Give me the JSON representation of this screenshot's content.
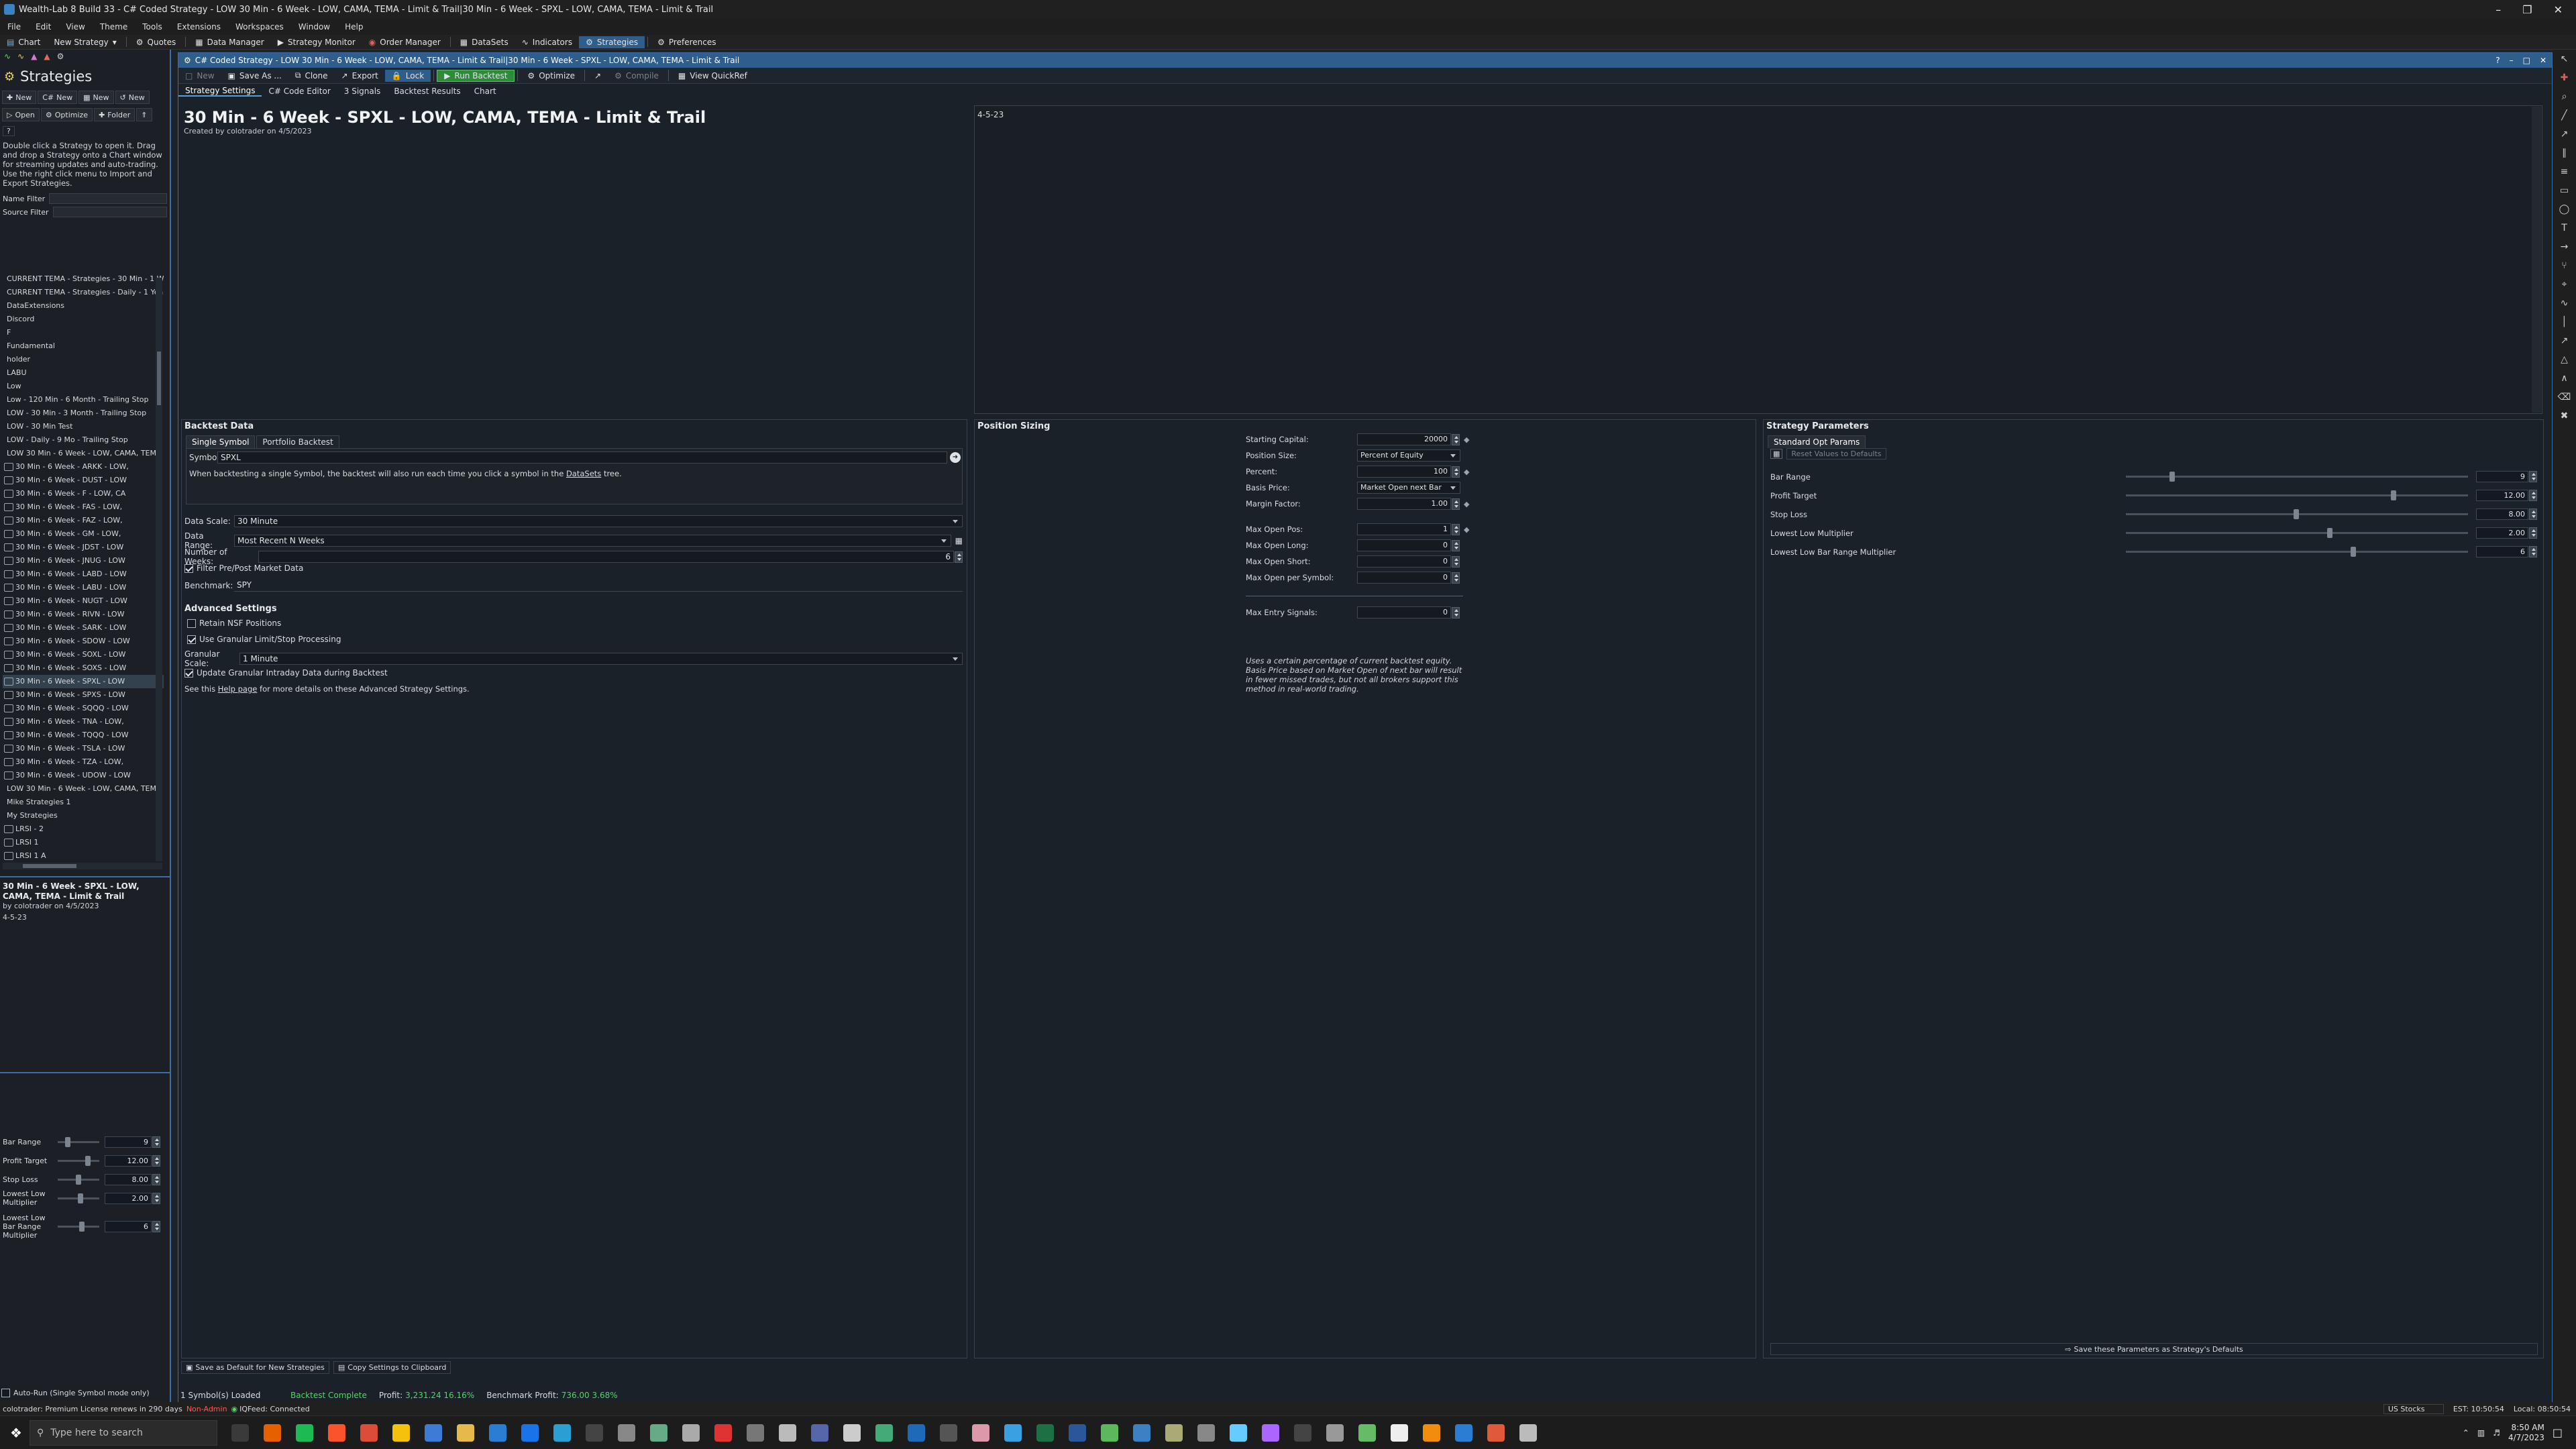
{
  "window": {
    "title": "Wealth-Lab 8 Build 33 - C# Coded Strategy - LOW 30 Min - 6 Week - LOW, CAMA, TEMA - Limit & Trail|30 Min - 6 Week - SPXL - LOW, CAMA, TEMA - Limit & Trail"
  },
  "menu": [
    "File",
    "Edit",
    "View",
    "Theme",
    "Tools",
    "Extensions",
    "Workspaces",
    "Window",
    "Help"
  ],
  "toolbar": {
    "chart": "Chart",
    "new_strategy": "New Strategy",
    "quotes": "Quotes",
    "data_manager": "Data Manager",
    "strategy_monitor": "Strategy Monitor",
    "order_manager": "Order Manager",
    "datasets": "DataSets",
    "indicators": "Indicators",
    "strategies": "Strategies",
    "preferences": "Preferences"
  },
  "left": {
    "title": "Strategies",
    "buttons1": [
      "New",
      "New",
      "New",
      "New"
    ],
    "buttons2": [
      "Open",
      "Optimize",
      "Folder"
    ],
    "hint": "Double click a Strategy to open it. Drag and drop a Strategy onto a Chart window for streaming updates and auto-trading. Use the right click menu to Import and Export Strategies.",
    "name_filter": "Name Filter",
    "source_filter": "Source Filter",
    "folders": [
      "CURRENT TEMA - Strategies - 30 Min - 1 W",
      "CURRENT TEMA - Strategies - Daily - 1 Year",
      "DataExtensions",
      "Discord",
      "F",
      "Fundamental",
      "holder",
      "LABU",
      "Low",
      "Low - 120 Min - 6 Month - Trailing Stop",
      "LOW - 30 Min - 3 Month - Trailing Stop",
      "LOW - 30 Min Test",
      "LOW - Daily - 9 Mo - Trailing Stop",
      "LOW 30 Min - 6 Week - LOW, CAMA, TEMA"
    ],
    "strategies": [
      "30 Min - 6 Week - ARKK - LOW,",
      "30 Min - 6 Week - DUST - LOW",
      "30 Min - 6 Week - F - LOW, CA",
      "30 Min - 6 Week - FAS - LOW,",
      "30 Min - 6 Week - FAZ - LOW,",
      "30 Min - 6 Week - GM - LOW,",
      "30 Min - 6 Week - JDST - LOW",
      "30 Min - 6 Week - JNUG - LOW",
      "30 Min - 6 Week - LABD - LOW",
      "30 Min - 6 Week - LABU - LOW",
      "30 Min - 6 Week - NUGT - LOW",
      "30 Min - 6 Week - RIVN - LOW",
      "30 Min - 6 Week - SARK - LOW",
      "30 Min - 6 Week - SDOW - LOW",
      "30 Min - 6 Week - SOXL - LOW",
      "30 Min - 6 Week - SOXS - LOW",
      "30 Min - 6 Week - SPXL - LOW",
      "30 Min - 6 Week - SPXS - LOW",
      "30 Min - 6 Week - SQQQ - LOW",
      "30 Min - 6 Week - TNA - LOW,",
      "30 Min - 6 Week - TQQQ - LOW",
      "30 Min - 6 Week - TSLA - LOW",
      "30 Min - 6 Week - TZA - LOW,",
      "30 Min - 6 Week - UDOW - LOW"
    ],
    "folders2": [
      "LOW 30 Min - 6 Week - LOW, CAMA, TEMA",
      "Mike Strategies 1",
      "My Strategies"
    ],
    "mine": [
      "LRSI - 2",
      "LRSI 1",
      "LRSI 1 A"
    ],
    "info_title": "30 Min - 6 Week - SPXL - LOW, CAMA, TEMA - Limit & Trail",
    "info_by": "by colotrader on 4/5/2023",
    "info_notes": "4-5-23",
    "params": [
      {
        "label": "Bar Range",
        "value": "9",
        "level": 0.2
      },
      {
        "label": "Profit Target",
        "value": "12.00",
        "level": 0.75
      },
      {
        "label": "Stop Loss",
        "value": "8.00",
        "level": 0.5
      },
      {
        "label": "Lowest Low Multiplier",
        "value": "2.00",
        "level": 0.55
      },
      {
        "label": "Lowest Low Bar Range Multiplier",
        "value": "6",
        "level": 0.6
      }
    ],
    "auto_run": "Auto-Run (Single Symbol mode only)"
  },
  "doc": {
    "title": "C# Coded Strategy - LOW 30 Min - 6 Week - LOW, CAMA, TEMA - Limit & Trail|30 Min - 6 Week - SPXL - LOW, CAMA, TEMA - Limit & Trail",
    "tools": {
      "new": "New",
      "save_as": "Save As ...",
      "clone": "Clone",
      "export": "Export",
      "lock": "Lock",
      "run": "Run Backtest",
      "optimize": "Optimize",
      "compile": "Compile",
      "quickref": "View QuickRef"
    },
    "tabs": [
      "Strategy Settings",
      "C# Code Editor",
      "3 Signals",
      "Backtest Results",
      "Chart"
    ],
    "heading": "30 Min - 6 Week - SPXL  - LOW, CAMA, TEMA - Limit & Trail",
    "created": "Created by colotrader on 4/5/2023",
    "notes": "4-5-23"
  },
  "backtest": {
    "title": "Backtest Data",
    "tabs": [
      "Single Symbol",
      "Portfolio Backtest"
    ],
    "symbol_label": "Symbol",
    "symbol": "SPXL",
    "help1": "When backtesting a single Symbol, the backtest will also run each time you click a symbol in the",
    "help1_link": "DataSets",
    "help1_end": "tree.",
    "data_scale_label": "Data Scale:",
    "data_scale": "30 Minute",
    "data_range_label": "Data Range:",
    "data_range": "Most Recent N Weeks",
    "weeks_label": "Number of Weeks:",
    "weeks": "6",
    "filter_prepost": "Filter Pre/Post Market Data",
    "benchmark_label": "Benchmark:",
    "benchmark": "SPY",
    "adv_title": "Advanced Settings",
    "retain_nsf": "Retain NSF Positions",
    "granular": "Use Granular Limit/Stop Processing",
    "granular_scale_label": "Granular Scale:",
    "granular_scale": "1 Minute",
    "update_granular": "Update Granular Intraday Data during Backtest",
    "see_this": "See this",
    "help_page": "Help page",
    "see_end": "for more details on these Advanced Strategy Settings.",
    "save_default": "Save as Default for New Strategies",
    "copy_clip": "Copy Settings to Clipboard"
  },
  "position": {
    "title": "Position Sizing",
    "starting_capital_label": "Starting Capital:",
    "starting_capital": "20000",
    "position_size_label": "Position Size:",
    "position_size": "Percent of Equity",
    "percent_label": "Percent:",
    "percent": "100",
    "basis_label": "Basis Price:",
    "basis": "Market Open next Bar",
    "margin_label": "Margin Factor:",
    "margin": "1.00",
    "max_open_pos_label": "Max Open Pos:",
    "max_open_pos": "1",
    "max_open_long_label": "Max Open Long:",
    "max_open_long": "0",
    "max_open_short_label": "Max Open Short:",
    "max_open_short": "0",
    "max_open_symbol_label": "Max Open per Symbol:",
    "max_open_symbol": "0",
    "max_entry_label": "Max Entry Signals:",
    "max_entry": "0",
    "note": "Uses a certain percentage of current backtest equity. Basis Price based on Market Open of next bar will result in fewer missed trades, but not all brokers support this method in real-world trading."
  },
  "strategy_params": {
    "title": "Strategy Parameters",
    "tab": "Standard Opt Params",
    "reset": "Reset Values to Defaults",
    "params": [
      {
        "label": "Bar Range",
        "value": "9",
        "level": 0.13
      },
      {
        "label": "Profit Target",
        "value": "12.00",
        "level": 0.79
      },
      {
        "label": "Stop Loss",
        "value": "8.00",
        "level": 0.5
      },
      {
        "label": "Lowest Low Multiplier",
        "value": "2.00",
        "level": 0.6
      },
      {
        "label": "Lowest Low Bar Range Multiplier",
        "value": "6",
        "level": 0.67
      }
    ],
    "save_defaults": "Save these Parameters as Strategy's Defaults"
  },
  "status": {
    "symbols_loaded": "1 Symbol(s) Loaded",
    "complete": "Backtest Complete",
    "profit_label": "Profit:",
    "profit": "3,231.24 16.16%",
    "bench_label": "Benchmark Profit:",
    "bench": "736.00 3.68%"
  },
  "bottom": {
    "license": "colotrader: Premium License renews in 290 days",
    "nonadmin": "Non-Admin",
    "iqfeed": "IQFeed: Connected",
    "market": "US Stocks",
    "est": "EST: 10:50:54",
    "local": "Local: 08:50:54"
  },
  "taskbar": {
    "search": "Type here to search",
    "time": "8:50 AM",
    "date": "4/7/2023"
  },
  "colors": {
    "accent": "#3b6ea5",
    "run": "#2e8b3a",
    "status_green": "#4cd964",
    "red": "#ff5a5a"
  }
}
